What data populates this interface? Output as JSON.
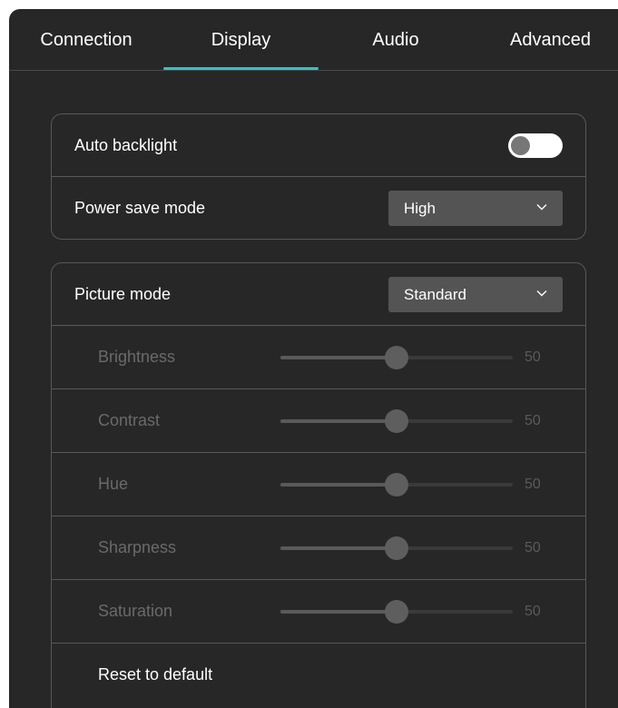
{
  "tabs": [
    {
      "label": "Connection"
    },
    {
      "label": "Display",
      "active": true
    },
    {
      "label": "Audio"
    },
    {
      "label": "Advanced"
    }
  ],
  "colors": {
    "accent": "#2ec4c7",
    "background": "#272727"
  },
  "general": {
    "auto_backlight": {
      "label": "Auto backlight",
      "enabled": false
    },
    "power_save_mode": {
      "label": "Power save mode",
      "value": "High",
      "icon": "chevron-down-icon"
    }
  },
  "picture": {
    "picture_mode": {
      "label": "Picture mode",
      "value": "Standard",
      "icon": "chevron-down-icon"
    },
    "sliders": [
      {
        "label": "Brightness",
        "value": "50",
        "fraction": 0.5
      },
      {
        "label": "Contrast",
        "value": "50",
        "fraction": 0.5
      },
      {
        "label": "Hue",
        "value": "50",
        "fraction": 0.5
      },
      {
        "label": "Sharpness",
        "value": "50",
        "fraction": 0.5
      },
      {
        "label": "Saturation",
        "value": "50",
        "fraction": 0.5
      }
    ],
    "reset_label": "Reset to default"
  }
}
